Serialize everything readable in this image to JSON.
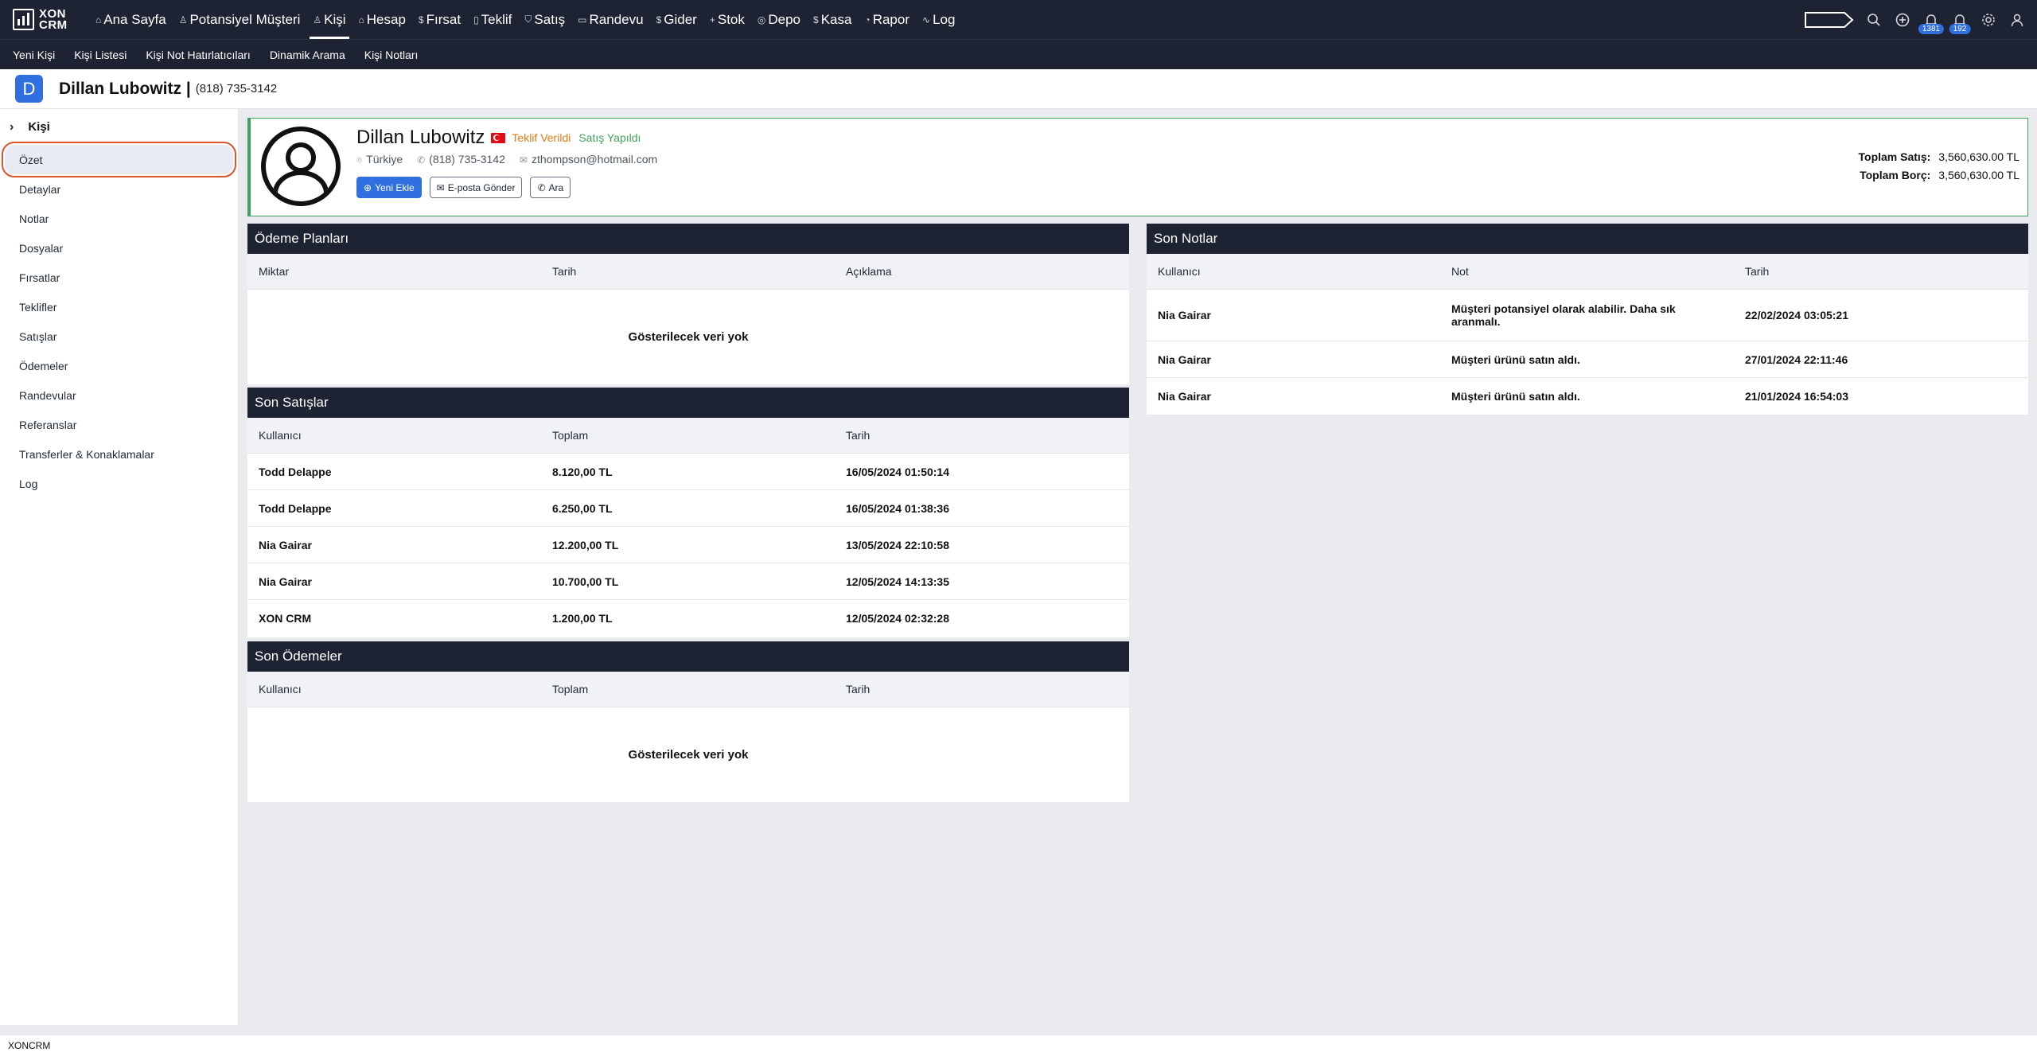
{
  "brand": {
    "line1": "XON",
    "line2": "CRM"
  },
  "nav": {
    "items": [
      {
        "icon": "⌂",
        "label": "Ana Sayfa"
      },
      {
        "icon": "♙",
        "label": "Potansiyel Müşteri"
      },
      {
        "icon": "♙",
        "label": "Kişi"
      },
      {
        "icon": "⌂",
        "label": "Hesap"
      },
      {
        "icon": "$",
        "label": "Fırsat"
      },
      {
        "icon": "▯",
        "label": "Teklif"
      },
      {
        "icon": "⛉",
        "label": "Satış"
      },
      {
        "icon": "▭",
        "label": "Randevu"
      },
      {
        "icon": "$",
        "label": "Gider"
      },
      {
        "icon": "+",
        "label": "Stok"
      },
      {
        "icon": "◎",
        "label": "Depo"
      },
      {
        "icon": "$",
        "label": "Kasa"
      },
      {
        "icon": "◔",
        "label": "Rapor"
      },
      {
        "icon": "∿",
        "label": "Log"
      }
    ],
    "notifications_count": "1381",
    "messages_count": "192"
  },
  "subnav": {
    "items": [
      "Yeni Kişi",
      "Kişi Listesi",
      "Kişi Not Hatırlatıcıları",
      "Dinamik Arama",
      "Kişi Notları"
    ]
  },
  "titlebar": {
    "initial": "D",
    "name": "Dillan Lubowitz |",
    "phone": "(818) 735-3142"
  },
  "sidebar": {
    "header": "Kişi",
    "items": [
      "Özet",
      "Detaylar",
      "Notlar",
      "Dosyalar",
      "Fırsatlar",
      "Teklifler",
      "Satışlar",
      "Ödemeler",
      "Randevular",
      "Referanslar",
      "Transferler & Konaklamalar",
      "Log"
    ]
  },
  "profile": {
    "name": "Dillan Lubowitz",
    "status_offer": "Teklif Verildi",
    "status_sale": "Satış Yapıldı",
    "country": "Türkiye",
    "phone": "(818) 735-3142",
    "email": "zthompson@hotmail.com",
    "btn_new": "Yeni Ekle",
    "btn_email": "E-posta Gönder",
    "btn_call": "Ara",
    "total_sales_label": "Toplam Satış:",
    "total_sales_value": "3,560,630.00 TL",
    "total_debt_label": "Toplam Borç:",
    "total_debt_value": "3,560,630.00 TL"
  },
  "payment_plans": {
    "title": "Ödeme Planları",
    "columns": [
      "Miktar",
      "Tarih",
      "Açıklama"
    ],
    "empty_text": "Gösterilecek veri yok"
  },
  "recent_sales": {
    "title": "Son Satışlar",
    "columns": [
      "Kullanıcı",
      "Toplam",
      "Tarih"
    ],
    "rows": [
      [
        "Todd Delappe",
        "8.120,00 TL",
        "16/05/2024 01:50:14"
      ],
      [
        "Todd Delappe",
        "6.250,00 TL",
        "16/05/2024 01:38:36"
      ],
      [
        "Nia Gairar",
        "12.200,00 TL",
        "13/05/2024 22:10:58"
      ],
      [
        "Nia Gairar",
        "10.700,00 TL",
        "12/05/2024 14:13:35"
      ],
      [
        "XON CRM",
        "1.200,00 TL",
        "12/05/2024 02:32:28"
      ]
    ]
  },
  "recent_payments": {
    "title": "Son Ödemeler",
    "columns": [
      "Kullanıcı",
      "Toplam",
      "Tarih"
    ],
    "empty_text": "Gösterilecek veri yok"
  },
  "recent_notes": {
    "title": "Son Notlar",
    "columns": [
      "Kullanıcı",
      "Not",
      "Tarih"
    ],
    "rows": [
      [
        "Nia Gairar",
        "Müşteri potansiyel olarak alabilir. Daha sık aranmalı.",
        "22/02/2024 03:05:21"
      ],
      [
        "Nia Gairar",
        "Müşteri ürünü satın aldı.",
        "27/01/2024 22:11:46"
      ],
      [
        "Nia Gairar",
        "Müşteri ürünü satın aldı.",
        "21/01/2024 16:54:03"
      ]
    ]
  },
  "footer": {
    "text": "XONCRM"
  }
}
